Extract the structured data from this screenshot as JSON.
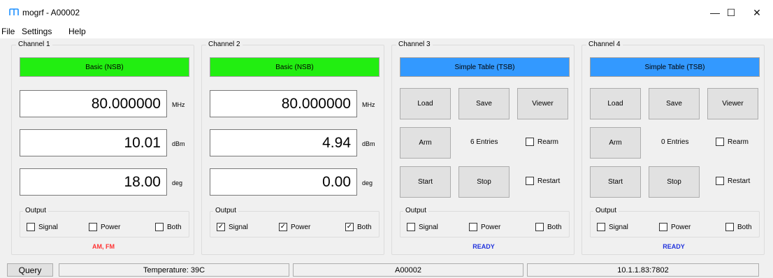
{
  "window": {
    "title": "mogrf - A00002",
    "minimize_glyph": "—",
    "maximize_glyph": "☐",
    "close_glyph": "✕"
  },
  "menu": [
    "File",
    "Settings",
    "Help"
  ],
  "channels": [
    {
      "title": "Channel 1",
      "mode": "Basic (NSB)",
      "frequency": "80.000000",
      "frequency_unit": "MHz",
      "power": "10.01",
      "power_unit": "dBm",
      "phase": "18.00",
      "phase_unit": "deg",
      "output_label": "Output",
      "signal_label": "Signal",
      "power_label": "Power",
      "both_label": "Both",
      "signal_checked": false,
      "power_checked": false,
      "both_checked": false,
      "status": "AM, FM"
    },
    {
      "title": "Channel 2",
      "mode": "Basic (NSB)",
      "frequency": "80.000000",
      "frequency_unit": "MHz",
      "power": "4.94",
      "power_unit": "dBm",
      "phase": "0.00",
      "phase_unit": "deg",
      "output_label": "Output",
      "signal_label": "Signal",
      "power_label": "Power",
      "both_label": "Both",
      "signal_checked": true,
      "power_checked": true,
      "both_checked": true,
      "status": ""
    },
    {
      "title": "Channel 3",
      "mode": "Simple Table (TSB)",
      "load_label": "Load",
      "save_label": "Save",
      "viewer_label": "Viewer",
      "arm_label": "Arm",
      "entries": "6 Entries",
      "rearm_label": "Rearm",
      "start_label": "Start",
      "stop_label": "Stop",
      "restart_label": "Restart",
      "output_label": "Output",
      "signal_label": "Signal",
      "power_label": "Power",
      "both_label": "Both",
      "status": "READY"
    },
    {
      "title": "Channel 4",
      "mode": "Simple Table (TSB)",
      "load_label": "Load",
      "save_label": "Save",
      "viewer_label": "Viewer",
      "arm_label": "Arm",
      "entries": "0 Entries",
      "rearm_label": "Rearm",
      "start_label": "Start",
      "stop_label": "Stop",
      "restart_label": "Restart",
      "output_label": "Output",
      "signal_label": "Signal",
      "power_label": "Power",
      "both_label": "Both",
      "status": "READY"
    }
  ],
  "statusbar": {
    "query_label": "Query",
    "temperature": "Temperature: 39C",
    "serial": "A00002",
    "address": "10.1.1.83:7802"
  },
  "check_glyph": "✓",
  "colors": {
    "basic_mode": "#22ee11",
    "table_mode": "#3399ff",
    "status_warning": "#ff3333",
    "status_ready": "#2233dd",
    "app_icon": "#1e90ff"
  }
}
